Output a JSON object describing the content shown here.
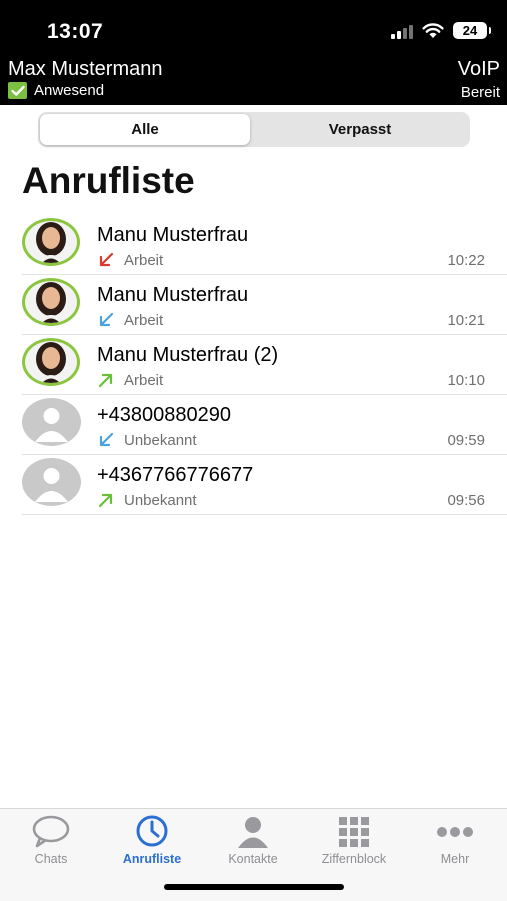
{
  "status_bar": {
    "time": "13:07",
    "battery": "24"
  },
  "header": {
    "user_name": "Max Mustermann",
    "presence": "Anwesend",
    "voip_title": "VoIP",
    "voip_status": "Bereit"
  },
  "segments": {
    "all": "Alle",
    "missed": "Verpasst",
    "selected": "Alle"
  },
  "page_title": "Anrufliste",
  "calls": [
    {
      "name": "Manu Musterfrau",
      "type": "Arbeit",
      "time": "10:22",
      "direction": "incoming-missed",
      "avatar": "photo"
    },
    {
      "name": "Manu Musterfrau",
      "type": "Arbeit",
      "time": "10:21",
      "direction": "incoming",
      "avatar": "photo"
    },
    {
      "name": "Manu Musterfrau (2)",
      "type": "Arbeit",
      "time": "10:10",
      "direction": "outgoing",
      "avatar": "photo"
    },
    {
      "name": "+43800880290",
      "type": "Unbekannt",
      "time": "09:59",
      "direction": "incoming",
      "avatar": "generic"
    },
    {
      "name": "+4367766776677",
      "type": "Unbekannt",
      "time": "09:56",
      "direction": "outgoing",
      "avatar": "generic"
    }
  ],
  "tabs": [
    {
      "label": "Chats",
      "icon": "chat-bubble-icon"
    },
    {
      "label": "Anrufliste",
      "icon": "clock-icon",
      "active": true
    },
    {
      "label": "Kontakte",
      "icon": "person-icon"
    },
    {
      "label": "Ziffernblock",
      "icon": "keypad-icon"
    },
    {
      "label": "Mehr",
      "icon": "more-dots-icon"
    }
  ],
  "colors": {
    "accent": "#2a6fd1",
    "presence_green": "#7bc043",
    "missed_red": "#d93a2f",
    "incoming_blue": "#4aa3df",
    "outgoing_green": "#6abf3a"
  }
}
